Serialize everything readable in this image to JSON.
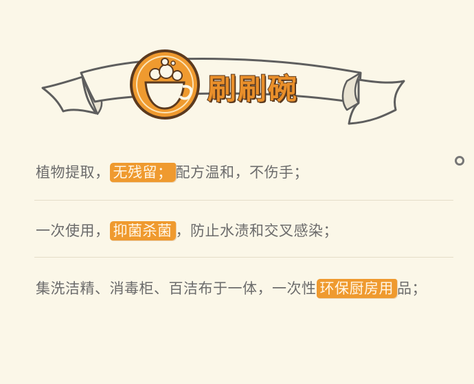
{
  "header": {
    "title": "刷刷碗",
    "icon": "bowl-bubbles-icon",
    "accent_color": "#ef9a2f"
  },
  "features": [
    {
      "before": "植物提取，",
      "highlight": "无残留；",
      "after": "配方温和，不伤手；"
    },
    {
      "before": "一次使用，",
      "highlight": "抑菌杀菌",
      "after": "，防止水渍和交叉感染；"
    },
    {
      "before": "集洗洁精、消毒柜、百洁布于一体，一次性",
      "highlight": "环保厨房用",
      "after": "品；"
    }
  ]
}
